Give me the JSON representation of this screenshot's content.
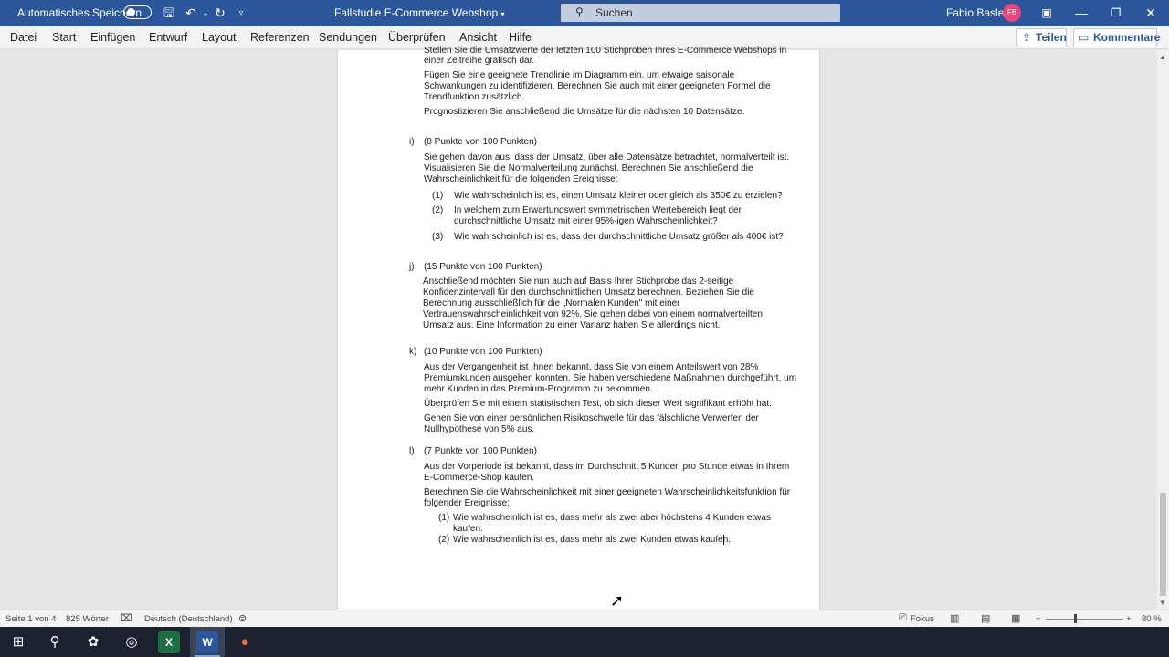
{
  "titlebar": {
    "autosave_label": "Automatisches Speichern",
    "doc_title": "Fallstudie E-Commerce Webshop",
    "search_placeholder": "Suchen",
    "user_name": "Fabio Basler",
    "user_initials": "FB"
  },
  "menu": {
    "items": [
      "Datei",
      "Start",
      "Einfügen",
      "Entwurf",
      "Layout",
      "Referenzen",
      "Sendungen",
      "Überprüfen",
      "Ansicht",
      "Hilfe"
    ],
    "share_label": "Teilen",
    "comments_label": "Kommentare"
  },
  "document": {
    "h_lines": [
      "Stellen Sie die Umsatzwerte der letzten 100 Stichproben Ihres E-Commerce Webshops in",
      "einer Zeitreihe grafisch dar.",
      "Fügen Sie eine geeignete Trendlinie im Diagramm ein, um etwaige saisonale",
      "Schwankungen zu identifizieren. Berechnen Sie auch mit einer geeigneten Formel die",
      "Trendfunktion zusätzlich.",
      "Prognostizieren Sie anschließend die Umsätze für die nächsten 10 Datensätze."
    ],
    "i_label": "i)",
    "i_points": "(8 Punkte von 100 Punkten)",
    "i_lines": [
      "Sie gehen davon aus, dass der Umsatz, über alle Datensätze betrachtet, normalverteilt ist.",
      "Visualisieren Sie die Normalverteilung zunächst. Berechnen Sie anschließend die",
      "Wahrscheinlichkeit für die folgenden Ereignisse:"
    ],
    "i_items": [
      {
        "num": "(1)",
        "lines": [
          "Wie wahrscheinlich ist es, einen Umsatz kleiner oder gleich als 350€ zu erzielen?"
        ]
      },
      {
        "num": "(2)",
        "lines": [
          "In welchem zum Erwartungswert symmetrischen Wertebereich liegt der",
          "durchschnittliche Umsatz mit einer 95%-igen Wahrscheinlichkeit?"
        ]
      },
      {
        "num": "(3)",
        "lines": [
          "Wie wahrscheinlich ist es, dass der durchschnittliche Umsatz größer als 400€ ist?"
        ]
      }
    ],
    "j_label": "j)",
    "j_points": "(15 Punkte von 100 Punkten)",
    "j_lines": [
      "Anschließend möchten Sie nun auch auf Basis Ihrer Stichprobe das 2-seitige",
      "Konfidenzintervall für den durchschnittlichen Umsatz berechnen. Beziehen Sie die",
      "Berechnung ausschließlich für die „Normalen Kunden\" mit einer",
      "Vertrauenswahrscheinlichkeit von 92%. Sie gehen dabei von einem normalverteilten",
      "Umsatz aus. Eine Information zu einer Varianz haben Sie allerdings nicht."
    ],
    "k_label": "k)",
    "k_points": "(10 Punkte von 100 Punkten)",
    "k_lines": [
      "Aus der Vergangenheit ist Ihnen bekannt, dass Sie von einem Anteilswert von 28%",
      "Premiumkunden ausgehen konnten. Sie haben verschiedene Maßnahmen durchgeführt, um",
      "mehr Kunden in das Premium-Programm zu bekommen.",
      "Überprüfen Sie mit einem statistischen Test, ob sich dieser Wert signifikant erhöht hat.",
      "Gehen Sie von einer persönlichen Risikoschwelle für das fälschliche Verwerfen der",
      "Nullhypothese von 5% aus."
    ],
    "l_label": "l)",
    "l_points": "(7 Punkte von 100 Punkten)",
    "l_lines": [
      "Aus der Vorperiode ist bekannt, dass im Durchschnitt 5 Kunden pro Stunde etwas in Ihrem",
      "E-Commerce-Shop kaufen.",
      "Berechnen Sie die Wahrscheinlichkeit mit einer geeigneten Wahrscheinlichkeitsfunktion für",
      "folgender Ereignisse:"
    ],
    "l_items": [
      {
        "num": "(1)",
        "lines": [
          "Wie wahrscheinlich ist es, dass mehr als zwei aber höchstens 4 Kunden etwas",
          "kaufen."
        ]
      },
      {
        "num": "(2)",
        "lines": [
          "Wie wahrscheinlich ist es, dass mehr als zwei Kunden etwas kaufen."
        ]
      }
    ]
  },
  "statusbar": {
    "page": "Seite 1 von 4",
    "words": "825 Wörter",
    "language": "Deutsch (Deutschland)",
    "focus": "Fokus",
    "zoom": "80 %"
  },
  "icons": {
    "save": "save-icon",
    "undo": "undo-icon",
    "redo": "redo-icon"
  },
  "colors": {
    "titlebar": "#2b579a",
    "avatar": "#e8467c"
  }
}
